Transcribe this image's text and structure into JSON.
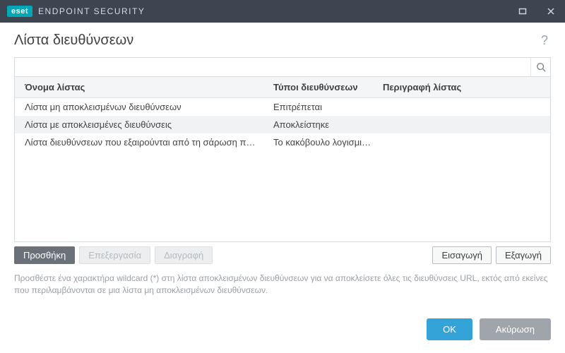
{
  "titlebar": {
    "brand_badge": "eset",
    "brand_name": "ENDPOINT SECURITY"
  },
  "header": {
    "title": "Λίστα διευθύνσεων",
    "help_glyph": "?"
  },
  "search": {
    "value": "",
    "placeholder": ""
  },
  "table": {
    "columns": {
      "name": "Όνομα λίστας",
      "types": "Τύποι διευθύνσεων",
      "desc": "Περιγραφή λίστας"
    },
    "rows": [
      {
        "name": "Λίστα μη αποκλεισμένων διευθύνσεων",
        "types": "Επιτρέπεται",
        "desc": ""
      },
      {
        "name": "Λίστα με αποκλεισμένες διευθύνσεις",
        "types": "Αποκλείστηκε",
        "desc": ""
      },
      {
        "name": "Λίστα διευθύνσεων που εξαιρούνται από τη σάρωση περιεχομέ...",
        "types": "Το κακόβουλο λογισμικό ...",
        "desc": ""
      }
    ]
  },
  "buttons": {
    "add": "Προσθήκη",
    "edit": "Επεξεργασία",
    "delete": "Διαγραφή",
    "import": "Εισαγωγή",
    "export": "Εξαγωγή"
  },
  "hint": "Προσθέστε ένα χαρακτήρα wildcard (*) στη λίστα αποκλεισμένων διευθύνσεων για να αποκλείσετε όλες τις διευθύνσεις URL, εκτός από εκείνες που περιλαμβάνονται σε μια λίστα μη αποκλεισμένων διευθύνσεων.",
  "footer": {
    "ok": "OK",
    "cancel": "Ακύρωση"
  }
}
